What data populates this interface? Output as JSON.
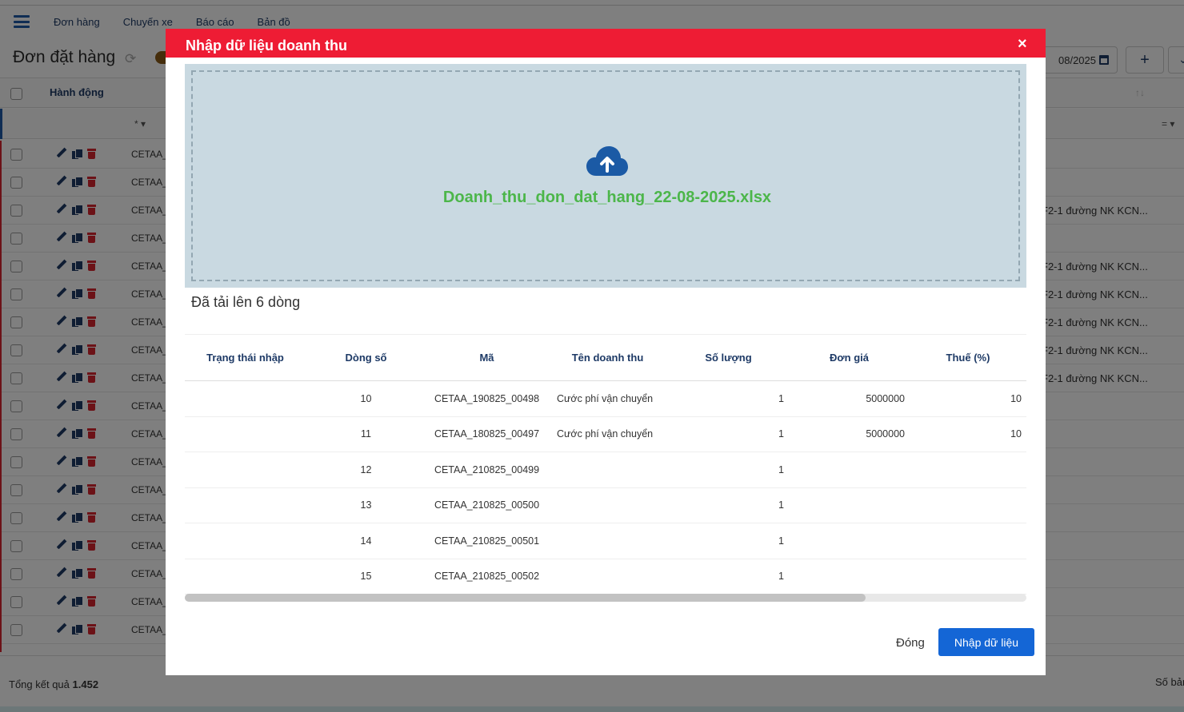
{
  "app": {
    "nav": [
      "Đơn hàng",
      "Chuyến xe",
      "Báo cáo",
      "Bản đồ"
    ],
    "page_title": "Đơn đặt hàng",
    "date_text": "08/2025",
    "add_label": "+",
    "grid": {
      "action_header": "Hành động",
      "filter_op_left": "* ▾",
      "filter_op_right": "= ▾",
      "row_code": "CETAA_",
      "row_addresses": [
        "",
        "",
        "F2-1 đường NK KCN...",
        "",
        "F2-1 đường NK KCN...",
        "F2-1 đường NK KCN...",
        "F2-1 đường NK KCN...",
        "F2-1 đường NK KCN...",
        "F2-1 đường NK KCN...",
        "",
        "",
        "",
        "",
        "",
        "",
        "",
        "",
        ""
      ]
    },
    "footer": {
      "total_label": "Tổng kết quả",
      "total_value": "1.452",
      "per_page_label": "Số bản ghi"
    }
  },
  "modal": {
    "title": "Nhập dữ liệu doanh thu",
    "close_symbol": "×",
    "file_name": "Doanh_thu_don_dat_hang_22-08-2025.xlsx",
    "upload_status": "Đã tải lên 6 dòng",
    "columns": [
      "Trạng thái nhập",
      "Dòng số",
      "Mã",
      "Tên doanh thu",
      "Số lượng",
      "Đơn giá",
      "Thuế (%)"
    ],
    "rows": [
      {
        "status": "",
        "line": "10",
        "code": "CETAA_190825_00498",
        "name": "Cước phí vận chuyển",
        "qty": "1",
        "price": "5000000",
        "tax": "10"
      },
      {
        "status": "",
        "line": "11",
        "code": "CETAA_180825_00497",
        "name": "Cước phí vận chuyển",
        "qty": "1",
        "price": "5000000",
        "tax": "10"
      },
      {
        "status": "",
        "line": "12",
        "code": "CETAA_210825_00499",
        "name": "",
        "qty": "1",
        "price": "",
        "tax": ""
      },
      {
        "status": "",
        "line": "13",
        "code": "CETAA_210825_00500",
        "name": "",
        "qty": "1",
        "price": "",
        "tax": ""
      },
      {
        "status": "",
        "line": "14",
        "code": "CETAA_210825_00501",
        "name": "",
        "qty": "1",
        "price": "",
        "tax": ""
      },
      {
        "status": "",
        "line": "15",
        "code": "CETAA_210825_00502",
        "name": "",
        "qty": "1",
        "price": "",
        "tax": ""
      }
    ],
    "buttons": {
      "close": "Đóng",
      "import": "Nhập dữ liệu"
    }
  },
  "colors": {
    "header_red": "#ee1c34",
    "primary_blue": "#1466d6",
    "file_green": "#4cb64a",
    "dropzone_bg": "#c9d9e1"
  },
  "icons": [
    "menu-icon",
    "refresh-icon",
    "calendar-icon",
    "edit-icon",
    "copy-icon",
    "delete-icon",
    "cloud-upload-icon",
    "close-icon"
  ]
}
